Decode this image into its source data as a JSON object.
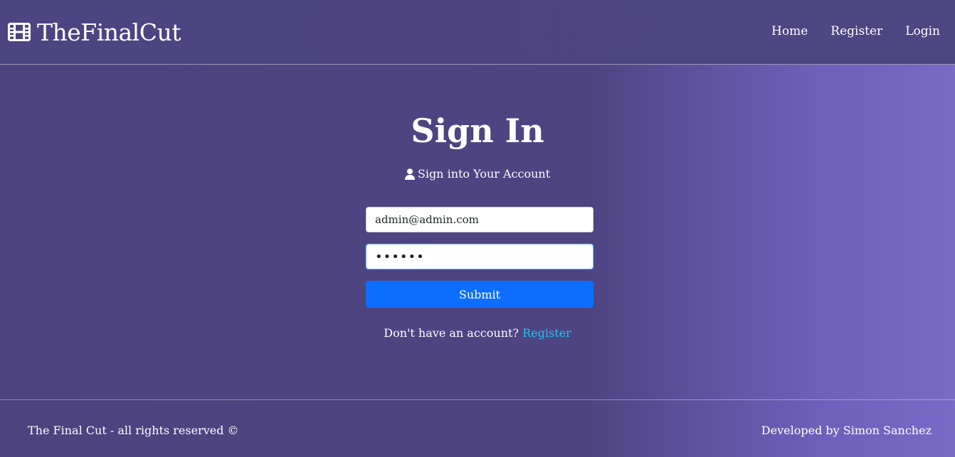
{
  "navbar": {
    "brand": "TheFinalCut",
    "brand_icon": "film-icon",
    "links": [
      "Home",
      "Register",
      "Login"
    ]
  },
  "signin": {
    "title": "Sign In",
    "subtitle": "Sign into Your Account",
    "subtitle_icon": "user-icon",
    "email_value": "admin@admin.com",
    "password_value": "••••••",
    "submit_label": "Submit",
    "register_prompt": "Don't have an account?",
    "register_link": "Register"
  },
  "footer": {
    "left": "The Final Cut - all rights reserved ©",
    "right": "Developed by Simon Sanchez"
  },
  "colors": {
    "accent_button": "#0d6efd",
    "link": "#20c3f2",
    "background_start": "#4c437f",
    "background_end": "#7a6ac7"
  }
}
